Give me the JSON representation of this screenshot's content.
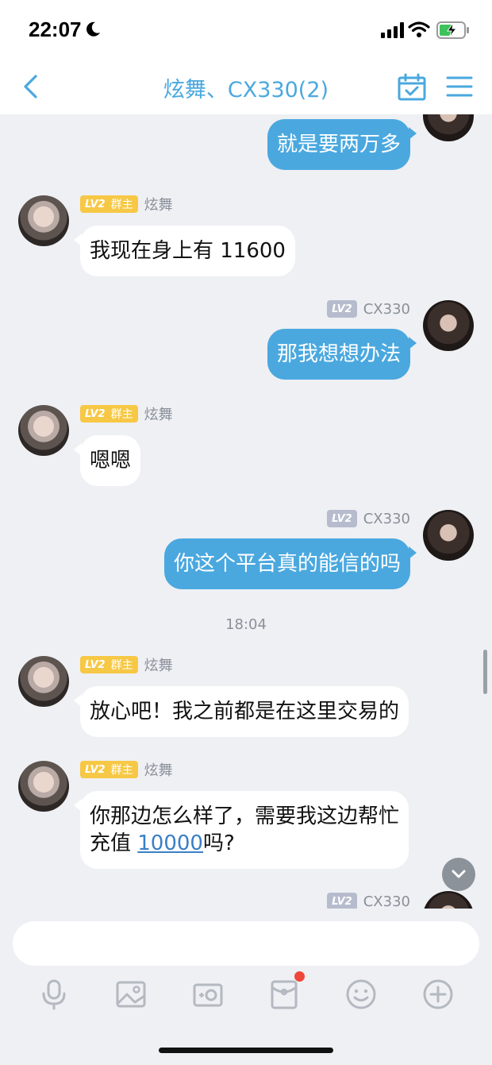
{
  "status": {
    "time": "22:07"
  },
  "header": {
    "title": "炫舞、CX330(2)"
  },
  "badges": {
    "level": "LV2",
    "owner_role": "群主"
  },
  "users": {
    "other": "炫舞",
    "self": "CX330"
  },
  "messages": [
    {
      "text": "就是要两万多"
    },
    {
      "text": "我现在身上有 11600"
    },
    {
      "text": "那我想想办法"
    },
    {
      "text": "嗯嗯"
    },
    {
      "text": "你这个平台真的能信的吗"
    },
    {
      "text": "放心吧！我之前都是在这里交易的"
    },
    {
      "line1": "你那边怎么样了，需要我这边帮忙",
      "line2_pre": "充值 ",
      "link": "10000",
      "line2_post": "吗?"
    }
  ],
  "timestamp": "18:04",
  "colors": {
    "accent": "#4aa8df",
    "owner_badge": "#f7c845",
    "level_badge": "#b6bccd",
    "notification_dot": "#f0473b"
  },
  "icons": [
    "moon-icon",
    "signal-icon",
    "wifi-icon",
    "battery-icon",
    "back-icon",
    "calendar-check-icon",
    "menu-icon",
    "chevron-down-icon",
    "microphone-icon",
    "image-icon",
    "camera-icon",
    "red-packet-icon",
    "emoji-icon",
    "plus-icon"
  ]
}
